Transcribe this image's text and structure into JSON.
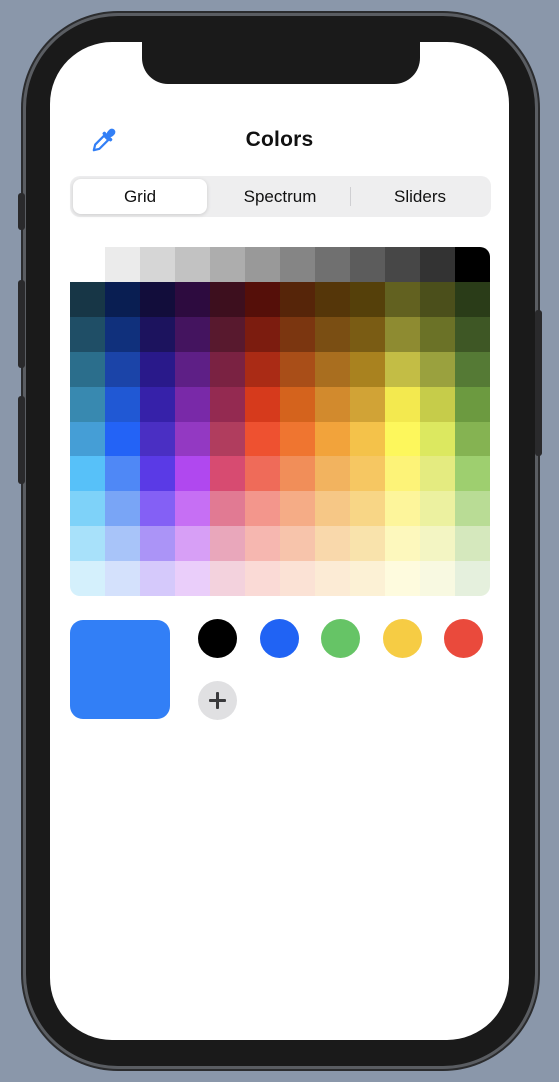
{
  "header": {
    "title": "Colors"
  },
  "tabs": {
    "selected": "Grid",
    "items": [
      "Grid",
      "Spectrum",
      "Sliders"
    ]
  },
  "selected_color": "#327ff6",
  "saved_colors": [
    "#000000",
    "#2063f4",
    "#66c466",
    "#f6cc44",
    "#ea4a3c"
  ],
  "grid": {
    "grays": [
      "#ffffff",
      "#ebebeb",
      "#d6d6d6",
      "#c2c2c2",
      "#adadad",
      "#999999",
      "#858585",
      "#707070",
      "#5c5c5c",
      "#474747",
      "#333333",
      "#000000"
    ],
    "rows": [
      [
        "#173646",
        "#091e52",
        "#120d3b",
        "#2d0b3f",
        "#3d0f1e",
        "#550f09",
        "#562509",
        "#553609",
        "#55400a",
        "#626120",
        "#4b4f1b",
        "#2a3c18"
      ],
      [
        "#1f4e66",
        "#10307c",
        "#1c135e",
        "#44145f",
        "#58192e",
        "#7c1c0f",
        "#7b3610",
        "#7a4e13",
        "#7a5c14",
        "#8e8b31",
        "#6b7227",
        "#3e5725"
      ],
      [
        "#2b6e8c",
        "#1b44a8",
        "#29198a",
        "#5e1f86",
        "#7a2242",
        "#aa2b15",
        "#a94e18",
        "#a96e1f",
        "#a9821f",
        "#c3bd45",
        "#9aa13e",
        "#557a35"
      ],
      [
        "#3889b0",
        "#2058d4",
        "#3621a9",
        "#7929a8",
        "#942a51",
        "#d63a1c",
        "#d4631d",
        "#d28a2d",
        "#d1a336",
        "#f3e94f",
        "#c6cc4a",
        "#6c9a40"
      ],
      [
        "#459ed6",
        "#2363f6",
        "#4a2fc3",
        "#9339c2",
        "#b03d5e",
        "#ee5130",
        "#ef7530",
        "#f2a33b",
        "#f4c24a",
        "#fdf75c",
        "#dce860",
        "#85b352"
      ],
      [
        "#57c1f9",
        "#4f88f6",
        "#5a3ae6",
        "#b048ef",
        "#d74b71",
        "#ef6b59",
        "#f18e59",
        "#f2b35f",
        "#f6c762",
        "#fdf378",
        "#e4eb80",
        "#9ecf6f"
      ],
      [
        "#7ed2f9",
        "#79a5f6",
        "#8460f5",
        "#c66ff4",
        "#e17a93",
        "#f3968c",
        "#f5ac86",
        "#f6c786",
        "#f8d686",
        "#fdf59b",
        "#ecf1a0",
        "#b9dc95"
      ],
      [
        "#a8e1fa",
        "#a8c4f9",
        "#ab94f7",
        "#d79ff6",
        "#e9a7bb",
        "#f6b7b0",
        "#f7c4ab",
        "#f9d8ab",
        "#f9e3ac",
        "#fdf8bd",
        "#f3f5c3",
        "#d5e8bd"
      ],
      [
        "#d4f0fc",
        "#d4e1fc",
        "#d5c9fb",
        "#eacefa",
        "#f3d2dd",
        "#fadad6",
        "#fbe2d5",
        "#fcebd5",
        "#fcf1d5",
        "#fefbde",
        "#f8f9e1",
        "#e5f0dd"
      ]
    ]
  }
}
